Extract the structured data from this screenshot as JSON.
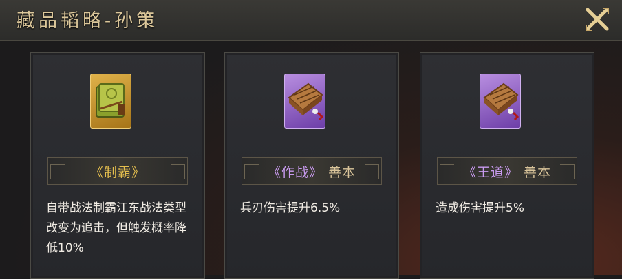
{
  "header": {
    "title": "藏品韬略-孙策"
  },
  "cards": [
    {
      "name": "《制霸》",
      "quality": "",
      "rarity_color": "gold",
      "description": "自带战法制霸江东战法类型改变为追击，但触发概率降低10%"
    },
    {
      "name": "《作战》",
      "quality": "善本",
      "rarity_color": "purple",
      "description": "兵刃伤害提升6.5%"
    },
    {
      "name": "《王道》",
      "quality": "善本",
      "rarity_color": "purple",
      "description": "造成伤害提升5%"
    }
  ],
  "colors": {
    "gold": "#e5bf4e",
    "purple": "#c99bf0",
    "title": "#dcc79a"
  },
  "icons": [
    "close-icon",
    "gold-scroll-icon",
    "purple-book-icon"
  ]
}
